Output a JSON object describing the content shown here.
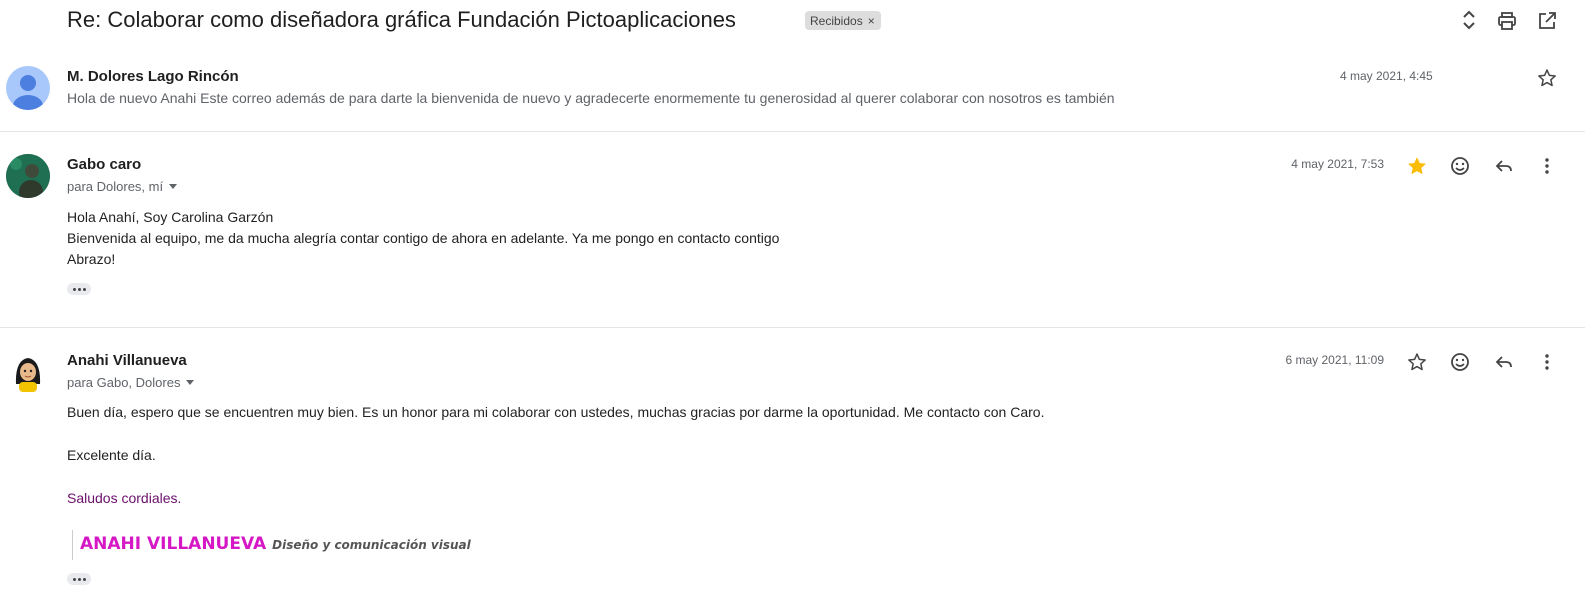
{
  "thread": {
    "subject": "Re: Colaborar como diseñadora gráfica Fundación Pictoaplicaciones",
    "label": "Recibidos",
    "label_remove": "×",
    "toolbar_icons": [
      "expand-collapse-icon",
      "print-icon",
      "open-new-window-icon"
    ]
  },
  "messages": [
    {
      "sender": "M. Dolores Lago Rincón",
      "date": "4 may 2021, 4:45",
      "snippet": "Hola de nuevo Anahi Este correo además de para darte la bienvenida de nuevo y agradecerte enormemente tu generosidad al querer colaborar con nosotros es también",
      "starred": false
    },
    {
      "sender": "Gabo caro",
      "recipients": "para Dolores, mí",
      "date": "4 may 2021, 7:53",
      "starred": true,
      "star_color": "#fbbc04",
      "body": [
        "Hola Anahí, Soy Carolina Garzón",
        "Bienvenida al equipo, me da mucha alegría contar contigo de ahora en adelante. Ya me pongo en contacto contigo",
        "Abrazo!"
      ]
    },
    {
      "sender": "Anahi Villanueva",
      "recipients": "para Gabo, Dolores",
      "date": "6 may 2021, 11:09",
      "starred": false,
      "body": [
        "Buen día, espero que se encuentren muy bien. Es un honor para mi colaborar con ustedes, muchas gracias por darme la oportunidad. Me contacto con Caro.",
        "Excelente día.",
        "Saludos cordiales."
      ],
      "signature": {
        "name": "ANAHI VILLANUEVA",
        "tagline": "Diseño y comunicación visual",
        "name_color": "#d617c5"
      }
    }
  ],
  "colors": {
    "avatar_default": "#a8c7fa",
    "avatar_default_fg": "#4d7fe0",
    "body_purple": "#6b0f6b"
  }
}
